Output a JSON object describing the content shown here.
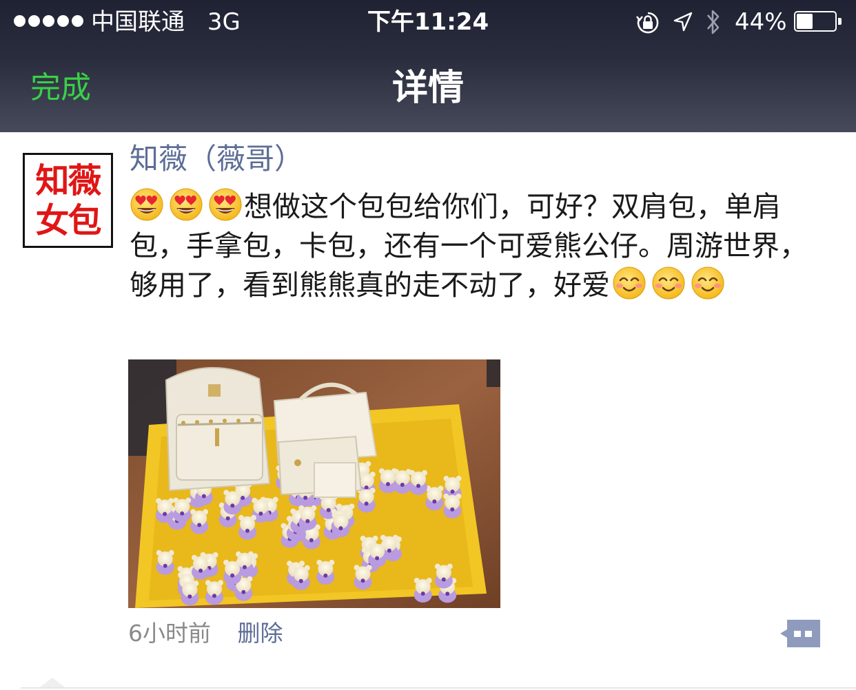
{
  "status_bar": {
    "carrier": "中国联通",
    "network": "3G",
    "time": "下午11:24",
    "battery_percent": "44%",
    "battery_level": 0.44,
    "icons": [
      "signal-dots-icon",
      "orientation-lock-icon",
      "location-icon",
      "bluetooth-icon",
      "battery-icon"
    ]
  },
  "nav": {
    "done_label": "完成",
    "title": "详情"
  },
  "post": {
    "avatar_text_line1": "知薇",
    "avatar_text_line2": "女包",
    "author": "知薇（薇哥）",
    "text_main": "想做这个包包给你们，可好？双肩包，单肩包，手拿包，卡包，还有一个可爱熊公仔。周游世界，够用了，看到熊熊真的走不动了，好爱",
    "leading_emoji": "heart-eyes-emoji",
    "trailing_emoji": "smiling-blush-emoji",
    "photo_alt": "photo-bags-and-teddy-bears",
    "time_ago": "6小时前",
    "delete_label": "删除"
  },
  "colors": {
    "done_green": "#3ad047",
    "link_blue": "#5d6d96",
    "avatar_red": "#e01616",
    "comment_btn": "#8e9bbd"
  }
}
